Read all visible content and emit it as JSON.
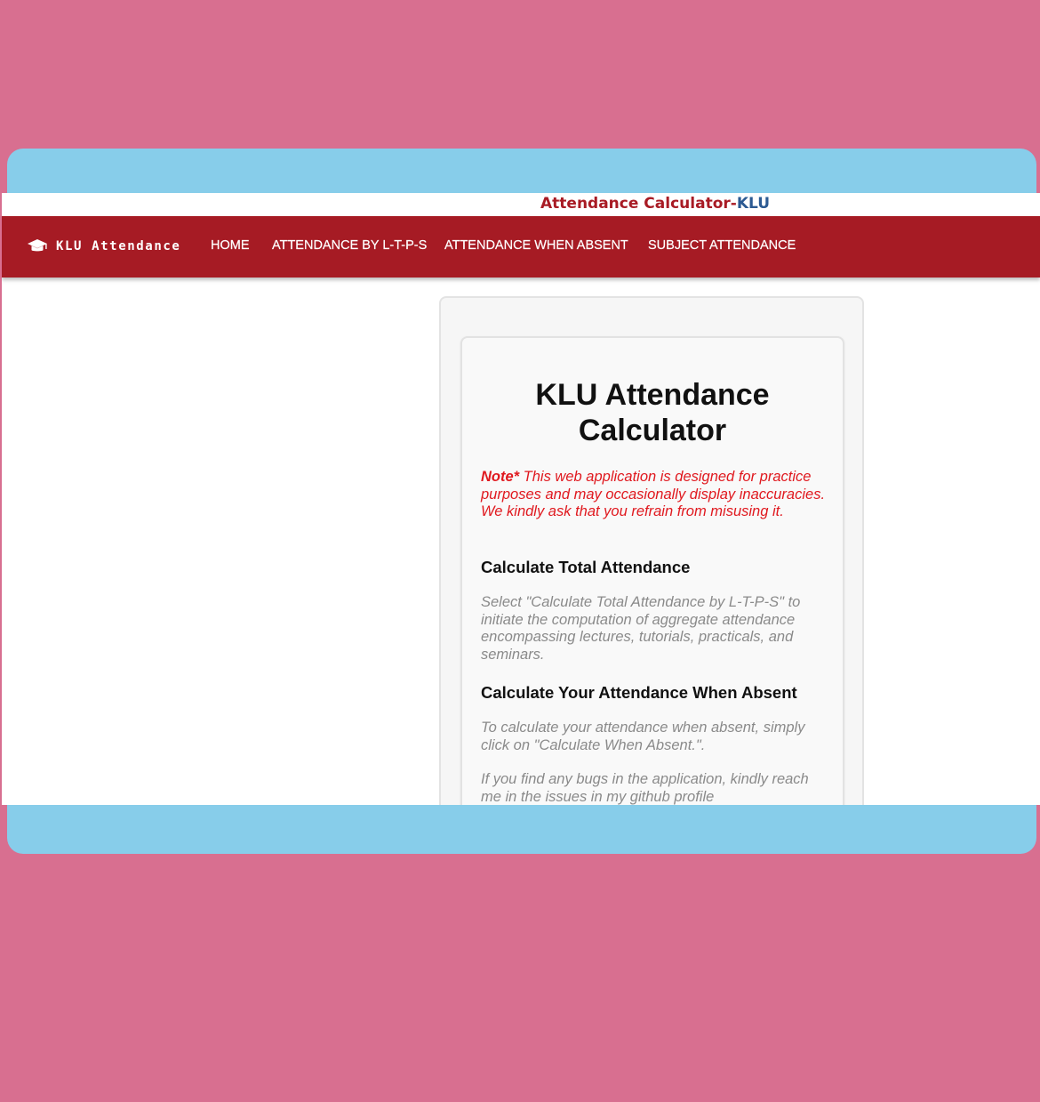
{
  "window": {
    "title_main": "Attendance Calculator-",
    "title_accent": "KLU"
  },
  "navbar": {
    "brand_label": "KLU Attendance",
    "brand_icon": "graduation-cap-icon",
    "links": [
      {
        "label": "HOME"
      },
      {
        "label": "ATTENDANCE BY L-T-P-S"
      },
      {
        "label": "ATTENDANCE WHEN ABSENT"
      },
      {
        "label": "SUBJECT ATTENDANCE"
      }
    ]
  },
  "card": {
    "heading_line1": "KLU Attendance",
    "heading_line2": "Calculator",
    "note_label": "Note*",
    "note_text": " This web application is designed for practice purposes and may occasionally display inaccuracies. We kindly ask that you refrain from misusing it.",
    "section1_title": "Calculate Total Attendance",
    "section1_text": "Select \"Calculate Total Attendance by L-T-P-S\" to initiate the computation of aggregate attendance encompassing lectures, tutorials, practicals, and seminars.",
    "section2_title": "Calculate Your Attendance When Absent",
    "section2_text": "To calculate your attendance when absent, simply click on \"Calculate When Absent.\".",
    "section3_text": "If you find any bugs in the application, kindly reach me in the issues in my github profile"
  },
  "colors": {
    "page_background": "#d86f90",
    "frame": "#87cdea",
    "navbar": "#a61b24",
    "title_main": "#a81b24",
    "title_accent": "#2c5a92",
    "note_text": "#e0191f",
    "muted_text": "#8a8a8a"
  }
}
